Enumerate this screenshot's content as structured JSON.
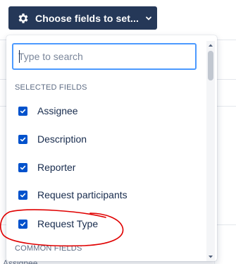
{
  "toolbar": {
    "choose_fields_label": "Choose fields to set...",
    "gear_icon": "gear-icon",
    "chevron_icon": "chevron-down-icon"
  },
  "dropdown": {
    "search": {
      "placeholder": "Type to search",
      "value": ""
    },
    "selected_header": "SELECTED FIELDS",
    "selected_fields": [
      {
        "label": "Assignee",
        "checked": true
      },
      {
        "label": "Description",
        "checked": true
      },
      {
        "label": "Reporter",
        "checked": true
      },
      {
        "label": "Request participants",
        "checked": true
      },
      {
        "label": "Request Type",
        "checked": true
      }
    ],
    "common_header": "COMMON FIELDS"
  },
  "background": {
    "partial_text": "Assignee"
  },
  "annotation": {
    "color": "#e00000",
    "highlighted_item": "Request Type"
  },
  "colors": {
    "button_bg": "#253858",
    "checkbox": "#0052cc",
    "focus_border": "#4c9aff"
  }
}
